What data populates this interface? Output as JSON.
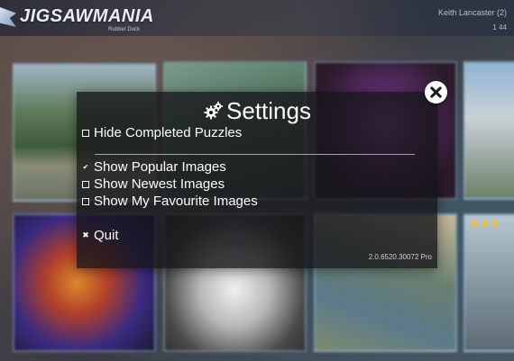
{
  "app": {
    "logo_text": "JIGSAWMANIA",
    "logo_sub": "Rubber Duck",
    "user_name": "Keith Lancaster (2)",
    "user_stat": "1 44"
  },
  "tiles": {
    "rating_stars": "★★★"
  },
  "settings": {
    "title": "Settings",
    "options": [
      {
        "label": "Hide Completed Puzzles",
        "checked": false
      },
      {
        "label": "Show Popular Images",
        "checked": true
      },
      {
        "label": "Show Newest Images",
        "checked": false
      },
      {
        "label": "Show My Favourite Images",
        "checked": false
      }
    ],
    "quit_label": "Quit",
    "version": "2.0.6520.30072 Pro",
    "close_icon": "close-icon",
    "title_icon": "gears-icon"
  },
  "colors": {
    "dialog_bg": "#141418",
    "text": "#ffffff",
    "accent_star": "#f2c230"
  }
}
